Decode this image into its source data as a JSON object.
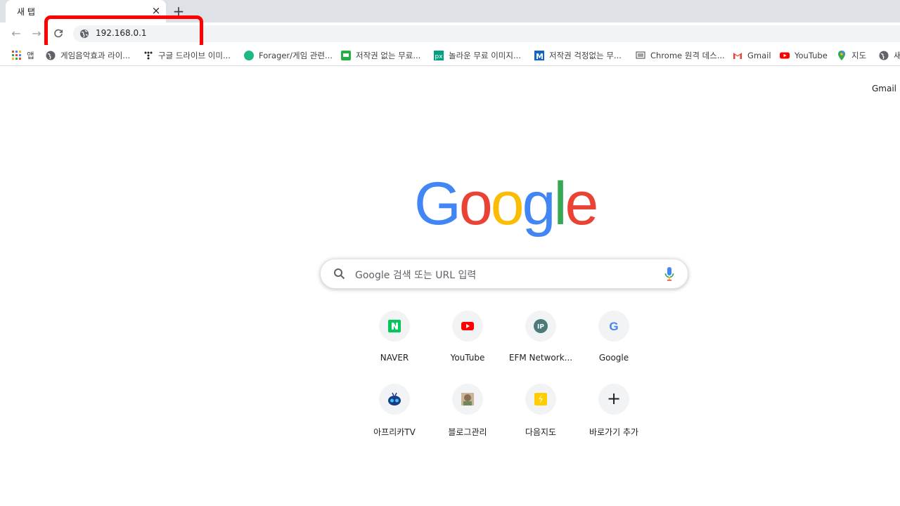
{
  "tab": {
    "title": "새 탭",
    "close": "×",
    "new_tab": "+"
  },
  "toolbar": {
    "back": "←",
    "forward": "→",
    "reload": "C"
  },
  "omnibox": {
    "url": "192.168.0.1"
  },
  "bookmarks": [
    {
      "label": "앱",
      "icon": "apps-grid-icon"
    },
    {
      "label": "게임음악효과 라이...",
      "icon": "globe-icon"
    },
    {
      "label": "구글 드라이브 이미...",
      "icon": "dots-icon"
    },
    {
      "label": "Forager/게임 관련...",
      "icon": "green-circle-icon"
    },
    {
      "label": "저작권 없는 무료...",
      "icon": "green-square-icon"
    },
    {
      "label": "놀라운 무료 이미지...",
      "icon": "px-icon"
    },
    {
      "label": "저작권 걱정없는 무...",
      "icon": "m-icon"
    },
    {
      "label": "Chrome 원격 데스...",
      "icon": "remote-desktop-icon"
    },
    {
      "label": "Gmail",
      "icon": "gmail-icon"
    },
    {
      "label": "YouTube",
      "icon": "youtube-icon"
    },
    {
      "label": "지도",
      "icon": "maps-pin-icon"
    },
    {
      "label": "새",
      "icon": "globe-icon"
    }
  ],
  "header": {
    "gmail": "Gmail"
  },
  "logo": {
    "letters": [
      "G",
      "o",
      "o",
      "g",
      "l",
      "e"
    ]
  },
  "search": {
    "placeholder": "Google 검색 또는 URL 입력"
  },
  "shortcuts": [
    {
      "label": "NAVER",
      "icon": "naver-icon"
    },
    {
      "label": "YouTube",
      "icon": "youtube-icon"
    },
    {
      "label": "EFM Network...",
      "icon": "ip-icon",
      "glyph": "IP"
    },
    {
      "label": "Google",
      "icon": "google-g-icon",
      "glyph": "G"
    },
    {
      "label": "아프리카TV",
      "icon": "afreecatv-icon"
    },
    {
      "label": "블로그관리",
      "icon": "blog-avatar-icon"
    },
    {
      "label": "다음지도",
      "icon": "daum-map-icon"
    },
    {
      "label": "바로가기 추가",
      "icon": "plus-icon",
      "glyph": "+"
    }
  ],
  "colors": {
    "blue": "#4285f4",
    "red": "#ea4335",
    "yellow": "#fbbc05",
    "green": "#34a853",
    "highlight": "#ff0000"
  }
}
